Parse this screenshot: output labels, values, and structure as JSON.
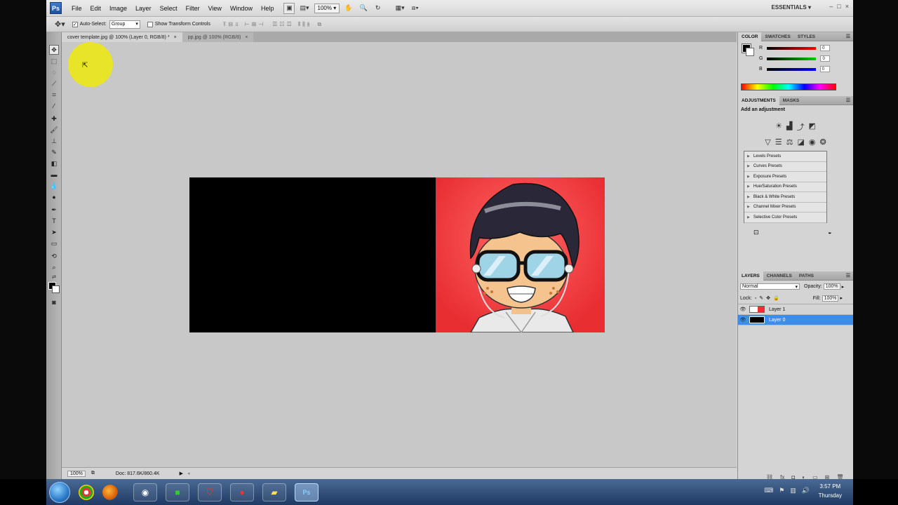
{
  "app": {
    "logo": "Ps",
    "menu": [
      "File",
      "Edit",
      "Image",
      "Layer",
      "Select",
      "Filter",
      "View",
      "Window",
      "Help"
    ],
    "zoom": "100%",
    "workspace": "ESSENTIALS",
    "window_controls": [
      "–",
      "□",
      "×"
    ]
  },
  "options_bar": {
    "auto_select_label": "Auto-Select:",
    "auto_select_value": "Group",
    "show_transform_label": "Show Transform Controls"
  },
  "tabs": [
    {
      "label": "cover template.jpg @ 100% (Layer 0, RGB/8) *",
      "close": "×"
    },
    {
      "label": "pp.jpg @ 100% (RGB/8)",
      "close": "×"
    }
  ],
  "status": {
    "zoom": "100%",
    "doc": "Doc: 817.6K/860.4K"
  },
  "color_panel": {
    "tabs": [
      "COLOR",
      "SWATCHES",
      "STYLES"
    ],
    "channels": [
      {
        "label": "R",
        "value": "0",
        "color": "#d61a1a"
      },
      {
        "label": "G",
        "value": "0",
        "color": "#1ea21e"
      },
      {
        "label": "B",
        "value": "0",
        "color": "#1d3fd6"
      }
    ]
  },
  "adjustments_panel": {
    "tabs": [
      "ADJUSTMENTS",
      "MASKS"
    ],
    "heading": "Add an adjustment",
    "presets": [
      "Levels Presets",
      "Curves Presets",
      "Exposure Presets",
      "Hue/Saturation Presets",
      "Black & White Presets",
      "Channel Mixer Presets",
      "Selective Color Presets"
    ]
  },
  "layers_panel": {
    "tabs": [
      "LAYERS",
      "CHANNELS",
      "PATHS"
    ],
    "blend_mode": "Normal",
    "opacity_label": "Opacity:",
    "opacity_value": "100%",
    "lock_label": "Lock:",
    "fill_label": "Fill:",
    "fill_value": "100%",
    "layers": [
      {
        "name": "Layer 1",
        "selected": false
      },
      {
        "name": "Layer 0",
        "selected": true
      }
    ]
  },
  "taskbar": {
    "time": "3:57 PM",
    "day": "Thursday"
  }
}
